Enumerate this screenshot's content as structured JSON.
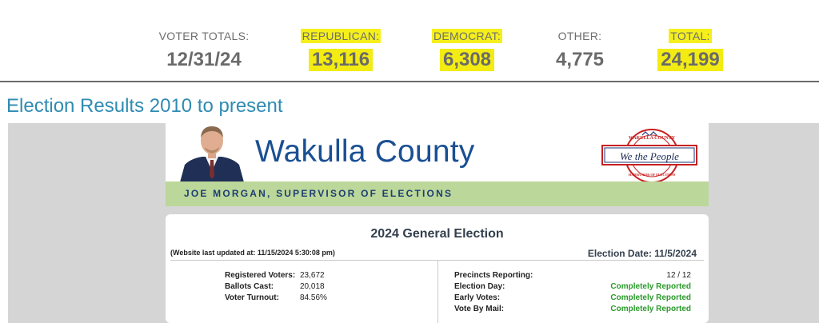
{
  "voter_totals": {
    "label": "VOTER TOTALS:",
    "date": "12/31/24",
    "republican": {
      "label": "REPUBLICAN:",
      "value": "13,116"
    },
    "democrat": {
      "label": "DEMOCRAT:",
      "value": "6,308"
    },
    "other": {
      "label": "OTHER:",
      "value": "4,775"
    },
    "total": {
      "label": "TOTAL:",
      "value": "24,199"
    },
    "highlight_color": "#f5ef1b"
  },
  "results_heading": "Election Results 2010 to present",
  "banner": {
    "county": "Wakulla County",
    "supervisor": "JOE MORGAN, SUPERVISOR OF ELECTIONS",
    "seal": {
      "top_text": "WAKULLA COUNTY",
      "script_text": "We the People",
      "bottom_text": "SUPERVISOR OF ELECTIONS"
    }
  },
  "election": {
    "title": "2024 General Election",
    "updated": "(Website last updated at: 11/15/2024 5:30:08 pm)",
    "date": "Election Date: 11/5/2024",
    "left_stats": [
      {
        "label": "Registered Voters:",
        "value": "23,672"
      },
      {
        "label": "Ballots Cast:",
        "value": "20,018"
      },
      {
        "label": "Voter Turnout:",
        "value": "84.56%"
      }
    ],
    "right_stats": [
      {
        "label": "Precincts Reporting:",
        "value": "12 / 12"
      },
      {
        "label": "Election Day:",
        "value": "Completely Reported"
      },
      {
        "label": "Early Votes:",
        "value": "Completely Reported"
      },
      {
        "label": "Vote By Mail:",
        "value": "Completely Reported"
      }
    ]
  },
  "colors": {
    "heading": "#2f8bb3",
    "county": "#1a4f93",
    "green_bar": "#bcd79a",
    "reported": "#2a9a2a"
  }
}
